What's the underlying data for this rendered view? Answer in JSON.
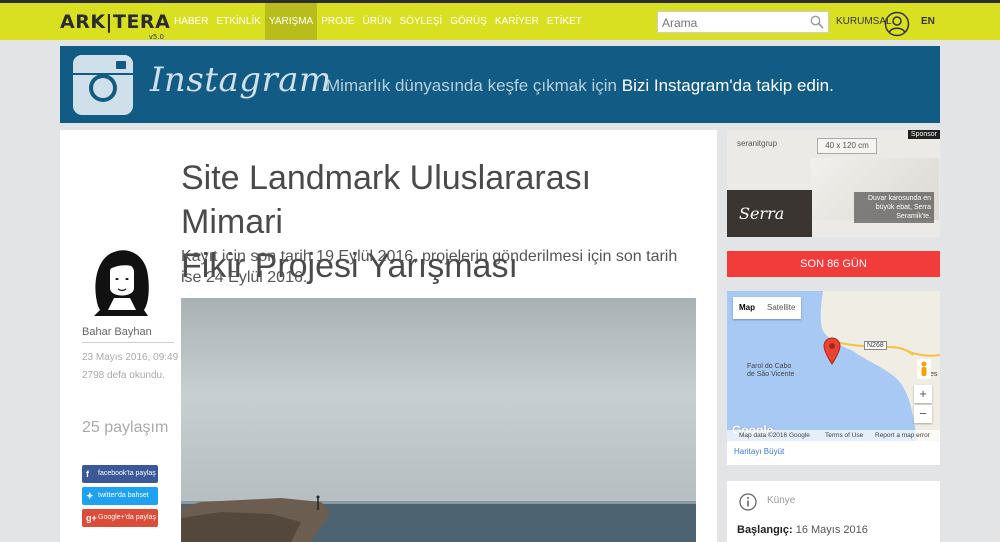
{
  "header": {
    "logo_text": "ARK|TERA",
    "logo_version": "v5.0",
    "nav": [
      "HABER",
      "ETKİNLİK",
      "YARIŞMA",
      "PROJE",
      "ÜRÜN",
      "SÖYLEŞİ",
      "GÖRÜŞ",
      "KARİYER",
      "ETİKET"
    ],
    "active_nav": "YARIŞMA",
    "search_placeholder": "Arama",
    "corporate_label": "KURUMSAL",
    "language": "EN"
  },
  "banner": {
    "brand": "Instagram",
    "text": "Mimarlık dünyasında keşfe çıkmak için",
    "cta": "Bizi Instagram'da takip edin."
  },
  "article": {
    "title_line1": "Site Landmark Uluslararası Mimari",
    "title_line2": "Fikir Projesi Yarışması",
    "lead": "Kayıt için son tarih 19 Eylül 2016, projelerin gönderilmesi için son tarih ise 24 Eylül 2016.",
    "author": "Bahar Bayhan",
    "date": "23 Mayıs 2016, 09:49",
    "reads": "2798  defa okundu.",
    "share_count": "25 paylaşım",
    "share_facebook": "facebook'ta paylaş",
    "share_twitter": "twitter'da bahset",
    "share_google": "Google+'da paylaş"
  },
  "ad": {
    "sponsor_label": "Sponsor",
    "brand": "seranitgrup",
    "size": "40 x 120 cm",
    "logo": "Serra",
    "copy": "Duvar karosunda en büyük ebat, Serra Seramik'te."
  },
  "countdown": "SON 86 GÜN",
  "map": {
    "type_map": "Map",
    "type_satellite": "Satellite",
    "place_label_1": "Farol do Cabo",
    "place_label_2": "de São Vicente",
    "road": "N268",
    "zoom_in": "+",
    "zoom_out": "−",
    "google": "Google",
    "attr_data": "Map data ©2016 Google",
    "attr_terms": "Terms of Use",
    "attr_report": "Report a map error",
    "enlarge": "Haritayı Büyüt",
    "edge_label": "es"
  },
  "kunye": {
    "heading": "Künye",
    "start_label": "Başlangıç:",
    "start_value": "16 Mayıs 2016"
  },
  "colors": {
    "topbar": "#d9e021",
    "banner": "#115b84",
    "countdown": "#f23b3b",
    "facebook": "#3b5998",
    "twitter": "#1da1f2",
    "google": "#dd4b39"
  }
}
